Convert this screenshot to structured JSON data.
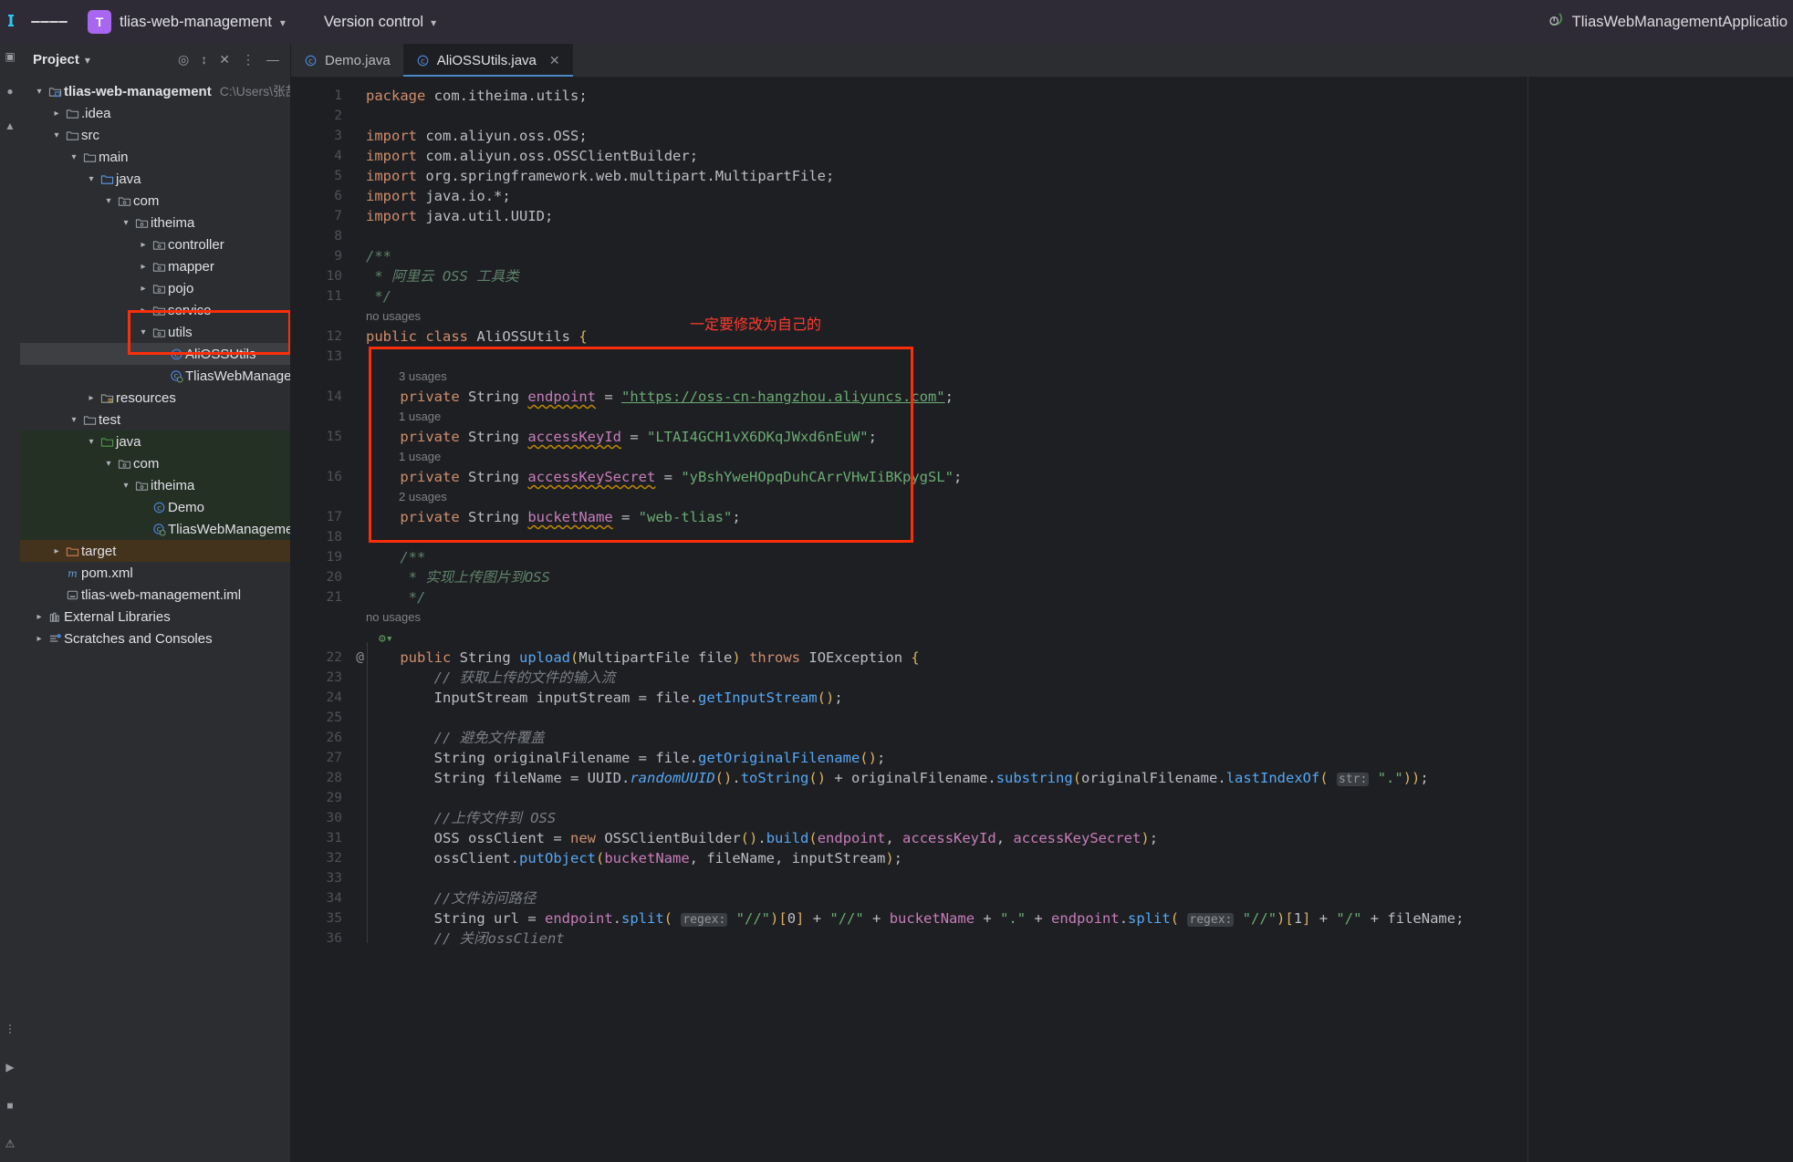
{
  "titlebar": {
    "menu_icon": "hamburger-menu-icon",
    "project_badge": "T",
    "project_name": "tlias-web-management",
    "vcs_label": "Version control",
    "run_config_name": "TliasWebManagementApplicatio"
  },
  "project_panel": {
    "title": "Project",
    "tools": [
      "target-icon",
      "collapse-icon",
      "close-icon",
      "more-icon",
      "minimize-icon"
    ],
    "tree": [
      {
        "indent": 0,
        "arrow": "down",
        "icon": "module-folder-icon",
        "label": "tlias-web-management",
        "sub": "C:\\Users\\张喆",
        "root": true
      },
      {
        "indent": 1,
        "arrow": "right",
        "icon": "folder-icon",
        "label": ".idea"
      },
      {
        "indent": 1,
        "arrow": "down",
        "icon": "folder-icon",
        "label": "src"
      },
      {
        "indent": 2,
        "arrow": "down",
        "icon": "folder-icon",
        "label": "main"
      },
      {
        "indent": 3,
        "arrow": "down",
        "icon": "source-folder-icon",
        "label": "java"
      },
      {
        "indent": 4,
        "arrow": "down",
        "icon": "package-icon",
        "label": "com"
      },
      {
        "indent": 5,
        "arrow": "down",
        "icon": "package-icon",
        "label": "itheima"
      },
      {
        "indent": 6,
        "arrow": "right",
        "icon": "package-icon",
        "label": "controller"
      },
      {
        "indent": 6,
        "arrow": "right",
        "icon": "package-icon",
        "label": "mapper"
      },
      {
        "indent": 6,
        "arrow": "right",
        "icon": "package-icon",
        "label": "pojo"
      },
      {
        "indent": 6,
        "arrow": "right",
        "icon": "package-icon",
        "label": "service"
      },
      {
        "indent": 6,
        "arrow": "down",
        "icon": "package-icon",
        "label": "utils"
      },
      {
        "indent": 7,
        "arrow": "none",
        "icon": "java-class-icon",
        "label": "AliOSSUtils",
        "selected": true
      },
      {
        "indent": 7,
        "arrow": "none",
        "icon": "spring-class-icon",
        "label": "TliasWebManagement"
      },
      {
        "indent": 3,
        "arrow": "right",
        "icon": "resource-folder-icon",
        "label": "resources"
      },
      {
        "indent": 2,
        "arrow": "down",
        "icon": "folder-icon",
        "label": "test"
      },
      {
        "indent": 3,
        "arrow": "down",
        "icon": "test-folder-icon",
        "label": "java",
        "tint": "green"
      },
      {
        "indent": 4,
        "arrow": "down",
        "icon": "package-icon",
        "label": "com",
        "tint": "green"
      },
      {
        "indent": 5,
        "arrow": "down",
        "icon": "package-icon",
        "label": "itheima",
        "tint": "green"
      },
      {
        "indent": 6,
        "arrow": "none",
        "icon": "java-class-icon",
        "label": "Demo",
        "tint": "green"
      },
      {
        "indent": 6,
        "arrow": "none",
        "icon": "spring-class-icon",
        "label": "TliasWebManagement",
        "tint": "green"
      },
      {
        "indent": 1,
        "arrow": "right",
        "icon": "excluded-folder-icon",
        "label": "target",
        "tint": "brown"
      },
      {
        "indent": 1,
        "arrow": "none",
        "icon": "maven-icon",
        "label": "pom.xml"
      },
      {
        "indent": 1,
        "arrow": "none",
        "icon": "iml-icon",
        "label": "tlias-web-management.iml"
      },
      {
        "indent": 0,
        "arrow": "right",
        "icon": "libraries-icon",
        "label": "External Libraries"
      },
      {
        "indent": 0,
        "arrow": "right",
        "icon": "scratches-icon",
        "label": "Scratches and Consoles"
      }
    ]
  },
  "editor": {
    "tabs": [
      {
        "icon": "java-class-icon",
        "label": "Demo.java",
        "active": false,
        "closable": false
      },
      {
        "icon": "java-class-icon",
        "label": "AliOSSUtils.java",
        "active": true,
        "closable": true
      }
    ],
    "annotation_cn": "一定要修改为自己的",
    "accent_red": "#fb2e0b",
    "lines": [
      {
        "n": 1,
        "text": "package com.itheima.utils;"
      },
      {
        "n": 2,
        "text": ""
      },
      {
        "n": 3,
        "text": "import com.aliyun.oss.OSS;"
      },
      {
        "n": 4,
        "text": "import com.aliyun.oss.OSSClientBuilder;"
      },
      {
        "n": 5,
        "text": "import org.springframework.web.multipart.MultipartFile;"
      },
      {
        "n": 6,
        "text": "import java.io.*;"
      },
      {
        "n": 7,
        "text": "import java.util.UUID;"
      },
      {
        "n": 8,
        "text": ""
      },
      {
        "n": 9,
        "text": "/**"
      },
      {
        "n": 10,
        "text": " * 阿里云 OSS 工具类"
      },
      {
        "n": 11,
        "text": " */"
      },
      {
        "n": 12,
        "text": "public class AliOSSUtils {",
        "hint": "no usages"
      },
      {
        "n": 13,
        "text": ""
      },
      {
        "n": 14,
        "text": "    private String endpoint = \"https://oss-cn-hangzhou.aliyuncs.com\";",
        "hint": "3 usages"
      },
      {
        "n": 15,
        "text": "    private String accessKeyId = \"LTAI4GCH1vX6DKqJWxd6nEuW\";",
        "hint": "1 usage"
      },
      {
        "n": 16,
        "text": "    private String accessKeySecret = \"yBshYweHOpqDuhCArrVHwIiBKpygSL\";",
        "hint": "1 usage"
      },
      {
        "n": 17,
        "text": "    private String bucketName = \"web-tlias\";",
        "hint": "2 usages"
      },
      {
        "n": 18,
        "text": ""
      },
      {
        "n": 19,
        "text": "    /**"
      },
      {
        "n": 20,
        "text": "     * 实现上传图片到OSS"
      },
      {
        "n": 21,
        "text": "     */"
      },
      {
        "n": 22,
        "text": "    public String upload(MultipartFile file) throws IOException {",
        "hint": "no usages",
        "gutter_mark": "@"
      },
      {
        "n": 23,
        "text": "        // 获取上传的文件的输入流"
      },
      {
        "n": 24,
        "text": "        InputStream inputStream = file.getInputStream();"
      },
      {
        "n": 25,
        "text": ""
      },
      {
        "n": 26,
        "text": "        // 避免文件覆盖"
      },
      {
        "n": 27,
        "text": "        String originalFilename = file.getOriginalFilename();"
      },
      {
        "n": 28,
        "text": "        String fileName = UUID.randomUUID().toString() + originalFilename.substring(originalFilename.lastIndexOf( str: \".\"));"
      },
      {
        "n": 29,
        "text": ""
      },
      {
        "n": 30,
        "text": "        //上传文件到 OSS"
      },
      {
        "n": 31,
        "text": "        OSS ossClient = new OSSClientBuilder().build(endpoint, accessKeyId, accessKeySecret);"
      },
      {
        "n": 32,
        "text": "        ossClient.putObject(bucketName, fileName, inputStream);"
      },
      {
        "n": 33,
        "text": ""
      },
      {
        "n": 34,
        "text": "        //文件访问路径"
      },
      {
        "n": 35,
        "text": "        String url = endpoint.split( regex: \"//\")[0] + \"//\" + bucketName + \".\" + endpoint.split( regex: \"//\")[1] + \"/\" + fileName;"
      },
      {
        "n": 36,
        "text": "        // 关闭ossClient"
      }
    ]
  }
}
